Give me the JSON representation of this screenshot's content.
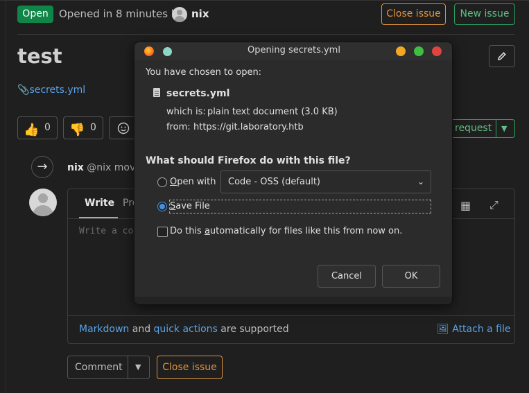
{
  "issue": {
    "status_badge": "Open",
    "opened_text": "Opened in 8 minutes by",
    "author": "nix",
    "close_issue_label": "Close issue",
    "new_issue_label": "New issue",
    "title": "test",
    "attachment_link": "secrets.yml",
    "reactions": {
      "thumbs_up_count": "0",
      "thumbs_down_count": "0"
    },
    "merge_request_label": "request"
  },
  "timeline": {
    "note_author": "nix",
    "note_handle": "@nix",
    "note_text": "move"
  },
  "editor": {
    "tab_write": "Write",
    "tab_preview": "Pre",
    "placeholder": "Write a co",
    "footer_markdown": "Markdown",
    "footer_and": "and",
    "footer_quick_actions": "quick actions",
    "footer_supported": "are supported",
    "attach_file_label": "Attach a file",
    "comment_label": "Comment",
    "close_issue_label": "Close issue"
  },
  "dialog": {
    "title": "Opening secrets.yml",
    "chosen_text": "You have chosen to open:",
    "file_name": "secrets.yml",
    "which_is_label": "which is:",
    "which_is_value": "plain text document (3.0 KB)",
    "from_label": "from:",
    "from_value": "https://git.laboratory.htb",
    "question": "What should Firefox do with this file?",
    "open_with_label": "pen with",
    "open_with_mnemonic": "O",
    "open_with_app": "Code - OSS (default)",
    "save_file_mnemonic": "S",
    "save_file_label": "ave File",
    "auto_prefix": "Do this ",
    "auto_mnemonic": "a",
    "auto_suffix": "utomatically for files like this from now on.",
    "cancel_label": "Cancel",
    "ok_label": "OK"
  },
  "icons": {
    "edit": "pencil-icon",
    "thumbs_up": "thumbs-up-icon",
    "thumbs_down": "thumbs-down-icon",
    "smile": "smile-icon",
    "arrow": "arrow-right-icon",
    "table": "table-icon",
    "expand": "expand-icon",
    "file": "file-icon"
  },
  "colors": {
    "open_badge": "#108548",
    "close_issue": "#e2933a",
    "new_issue": "#2da160",
    "link": "#5aa2e6",
    "radio_selected": "#4a90d9"
  }
}
